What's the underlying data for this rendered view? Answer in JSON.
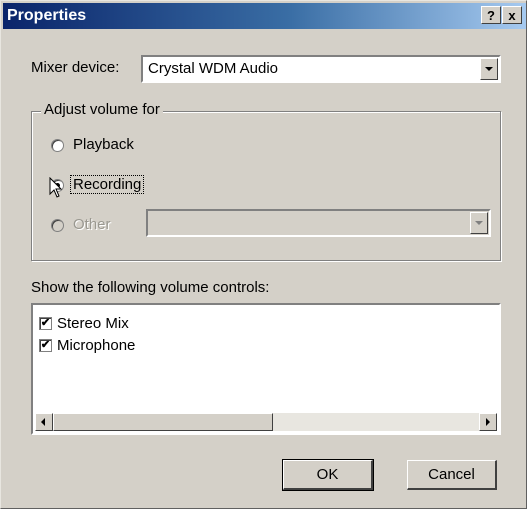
{
  "window": {
    "title": "Properties",
    "help_label": "?",
    "close_label": "x"
  },
  "mixer": {
    "label": "Mixer device:",
    "value": "Crystal WDM Audio"
  },
  "adjust_group": {
    "legend": "Adjust volume for",
    "options": [
      {
        "label": "Playback",
        "selected": false,
        "enabled": true
      },
      {
        "label": "Recording",
        "selected": true,
        "enabled": true
      },
      {
        "label": "Other",
        "selected": false,
        "enabled": false
      }
    ],
    "other_value": ""
  },
  "controls": {
    "label": "Show the following volume controls:",
    "items": [
      {
        "label": "Stereo Mix",
        "checked": true
      },
      {
        "label": "Microphone",
        "checked": true
      }
    ]
  },
  "buttons": {
    "ok": "OK",
    "cancel": "Cancel"
  },
  "icons": {
    "cursor": "mouse-pointer-icon",
    "dropdown": "chevron-down-icon",
    "scroll_left": "arrow-left-icon",
    "scroll_right": "arrow-right-icon"
  }
}
